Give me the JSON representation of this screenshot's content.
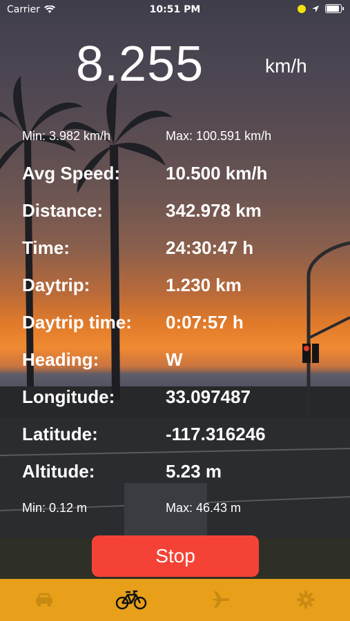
{
  "status": {
    "carrier": "Carrier",
    "time": "10:51 PM"
  },
  "speed": {
    "value": "8.255",
    "unit": "km/h",
    "min": "Min: 3.982 km/h",
    "max": "Max: 100.591 km/h"
  },
  "stats": [
    {
      "label": "Avg Speed:",
      "value": "10.500 km/h"
    },
    {
      "label": "Distance:",
      "value": "342.978 km"
    },
    {
      "label": "Time:",
      "value": "24:30:47 h"
    },
    {
      "label": "Daytrip:",
      "value": "1.230 km"
    },
    {
      "label": "Daytrip time:",
      "value": "0:07:57 h"
    },
    {
      "label": "Heading:",
      "value": "W"
    },
    {
      "label": "Longitude:",
      "value": "33.097487"
    },
    {
      "label": "Latitude:",
      "value": "-117.316246"
    },
    {
      "label": "Altitude:",
      "value": "5.23 m"
    }
  ],
  "altitude": {
    "min": "Min: 0.12 m",
    "max": "Max: 46.43 m"
  },
  "stop_label": "Stop",
  "tabbar": {
    "tabs": [
      {
        "icon": "car-icon",
        "selected": false
      },
      {
        "icon": "bicycle-icon",
        "selected": true
      },
      {
        "icon": "airplane-icon",
        "selected": false
      },
      {
        "icon": "gear-icon",
        "selected": false
      }
    ]
  }
}
